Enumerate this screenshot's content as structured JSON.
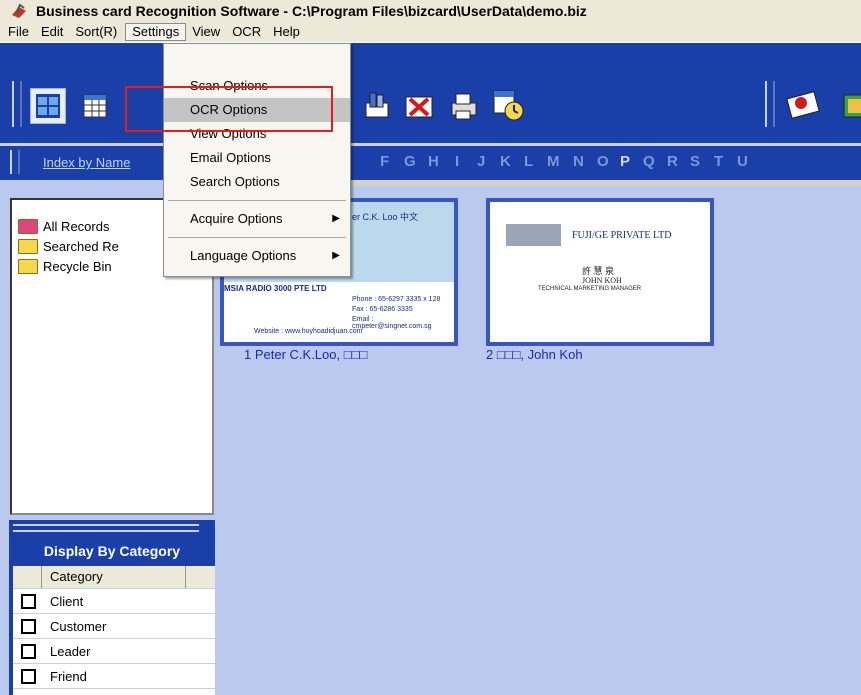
{
  "window": {
    "title": "Business card Recognition Software - C:\\Program Files\\bizcard\\UserData\\demo.biz"
  },
  "menubar": [
    "File",
    "Edit",
    "Sort(R)",
    "Settings",
    "View",
    "OCR",
    "Help"
  ],
  "settings_menu": {
    "group1": [
      "Scan Options",
      "OCR Options",
      "View Options",
      "Email Options",
      "Search Options"
    ],
    "acquire": "Acquire Options",
    "language": "Language Options",
    "highlighted": "OCR Options"
  },
  "alphabet": {
    "index_link": "Index by Name",
    "letters": [
      "F",
      "G",
      "H",
      "I",
      "J",
      "K",
      "L",
      "M",
      "N",
      "O",
      "P",
      "Q",
      "R",
      "S",
      "T",
      "U"
    ]
  },
  "tree": {
    "items": [
      "All Records",
      "Searched Re",
      "Recycle Bin"
    ]
  },
  "category": {
    "title": "Display By Category",
    "header": "Category",
    "items": [
      "Client",
      "Customer",
      "Leader",
      "Friend"
    ]
  },
  "cards": [
    {
      "caption": "1 Peter C.K.Loo, □□□",
      "name_line": "er C.K. Loo 中文",
      "company": "MSIA RADIO 3000 PTE LTD",
      "phone": "Phone : 65-6297 3335 x 128",
      "fax": "Fax : 65-6286 3335",
      "email": "Email : cmpeter@singnet.com.sg",
      "website": "Website : www.huyhoadidjuan.com"
    },
    {
      "caption": "2 □□□, John Koh",
      "company": "FUJI/GE PRIVATE LTD",
      "name_cn": "許 慧 泉",
      "name_en": "JOHN KOH",
      "job": "TECHNICAL MARKETING MANAGER"
    }
  ],
  "colors": {
    "toolbar": "#1a3fa8",
    "highlight": "#c4c4c4",
    "annotation": "#e31c1c",
    "card_border": "#3658c0"
  }
}
